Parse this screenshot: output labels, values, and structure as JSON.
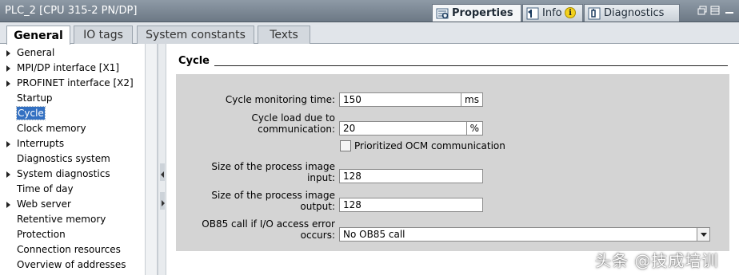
{
  "window": {
    "title": "PLC_2 [CPU 315-2 PN/DP]",
    "top_tabs": [
      {
        "label": "Properties",
        "icon": "properties-icon",
        "active": true
      },
      {
        "label": "Info",
        "icon": "info-icon",
        "badge": "i",
        "active": false
      },
      {
        "label": "Diagnostics",
        "icon": "diagnostics-icon",
        "active": false
      }
    ]
  },
  "tabs": [
    {
      "label": "General",
      "active": true
    },
    {
      "label": "IO tags",
      "active": false
    },
    {
      "label": "System constants",
      "active": false
    },
    {
      "label": "Texts",
      "active": false
    }
  ],
  "nav": {
    "items": [
      {
        "label": "General",
        "expandable": true,
        "selected": false
      },
      {
        "label": "MPI/DP interface [X1]",
        "expandable": true,
        "selected": false
      },
      {
        "label": "PROFINET interface [X2]",
        "expandable": true,
        "selected": false
      },
      {
        "label": "Startup",
        "expandable": false,
        "selected": false
      },
      {
        "label": "Cycle",
        "expandable": false,
        "selected": true
      },
      {
        "label": "Clock memory",
        "expandable": false,
        "selected": false
      },
      {
        "label": "Interrupts",
        "expandable": true,
        "selected": false
      },
      {
        "label": "Diagnostics system",
        "expandable": false,
        "selected": false
      },
      {
        "label": "System diagnostics",
        "expandable": true,
        "selected": false
      },
      {
        "label": "Time of day",
        "expandable": false,
        "selected": false
      },
      {
        "label": "Web server",
        "expandable": true,
        "selected": false
      },
      {
        "label": "Retentive memory",
        "expandable": false,
        "selected": false
      },
      {
        "label": "Protection",
        "expandable": false,
        "selected": false
      },
      {
        "label": "Connection resources",
        "expandable": false,
        "selected": false
      },
      {
        "label": "Overview of addresses",
        "expandable": false,
        "selected": false
      }
    ]
  },
  "cycle": {
    "section_title": "Cycle",
    "monitoring_time": {
      "label": "Cycle monitoring time:",
      "value": "150",
      "unit": "ms"
    },
    "cycle_load": {
      "label_line1": "Cycle load due to",
      "label_line2": "communication:",
      "value": "20",
      "unit": "%"
    },
    "prioritized_ocm": {
      "label": "Prioritized OCM communication",
      "checked": false
    },
    "pi_input": {
      "label_line1": "Size of the process image",
      "label_line2": "input:",
      "value": "128"
    },
    "pi_output": {
      "label_line1": "Size of the process image",
      "label_line2": "output:",
      "value": "128"
    },
    "ob85": {
      "label_line1": "OB85 call if I/O access error",
      "label_line2": "occurs:",
      "value": "No OB85 call"
    }
  },
  "watermark": "头条 @技成培训",
  "colors": {
    "titlebar": "#7b8794",
    "selection": "#3370c2",
    "panel": "#d4d4d4"
  }
}
